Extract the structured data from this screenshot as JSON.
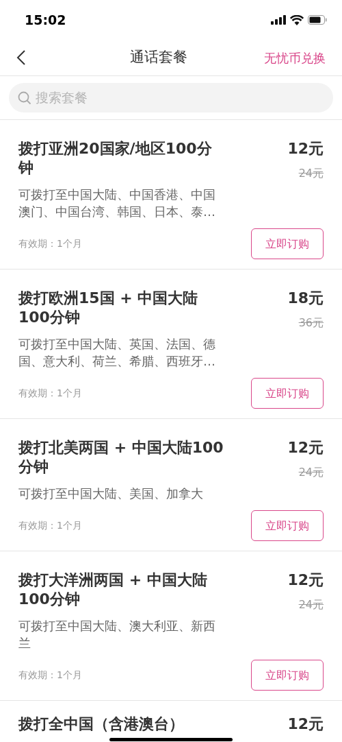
{
  "status_bar": {
    "time": "15:02"
  },
  "nav": {
    "title": "通话套餐",
    "action": "无忧币兑换"
  },
  "search": {
    "placeholder": "搜索套餐"
  },
  "plans": [
    {
      "title": "拨打亚洲20国家/地区100分钟",
      "description": "可拨打至中国大陆、中国香港、中国澳门、中国台湾、韩国、日本、泰…",
      "validity": "有效期：1个月",
      "price": "12元",
      "original_price": "24元",
      "button": "立即订购"
    },
    {
      "title": "拨打欧洲15国 + 中国大陆100分钟",
      "description": "可拨打至中国大陆、英国、法国、德国、意大利、荷兰、希腊、西班牙…",
      "validity": "有效期：1个月",
      "price": "18元",
      "original_price": "36元",
      "button": "立即订购"
    },
    {
      "title": "拨打北美两国 + 中国大陆100分钟",
      "description": "可拨打至中国大陆、美国、加拿大",
      "validity": "有效期：1个月",
      "price": "12元",
      "original_price": "24元",
      "button": "立即订购"
    },
    {
      "title": "拨打大洋洲两国 + 中国大陆100分钟",
      "description": "可拨打至中国大陆、澳大利亚、新西兰",
      "validity": "有效期：1个月",
      "price": "12元",
      "original_price": "24元",
      "button": "立即订购"
    },
    {
      "title": "拨打全中国（含港澳台）",
      "price": "12元"
    }
  ]
}
